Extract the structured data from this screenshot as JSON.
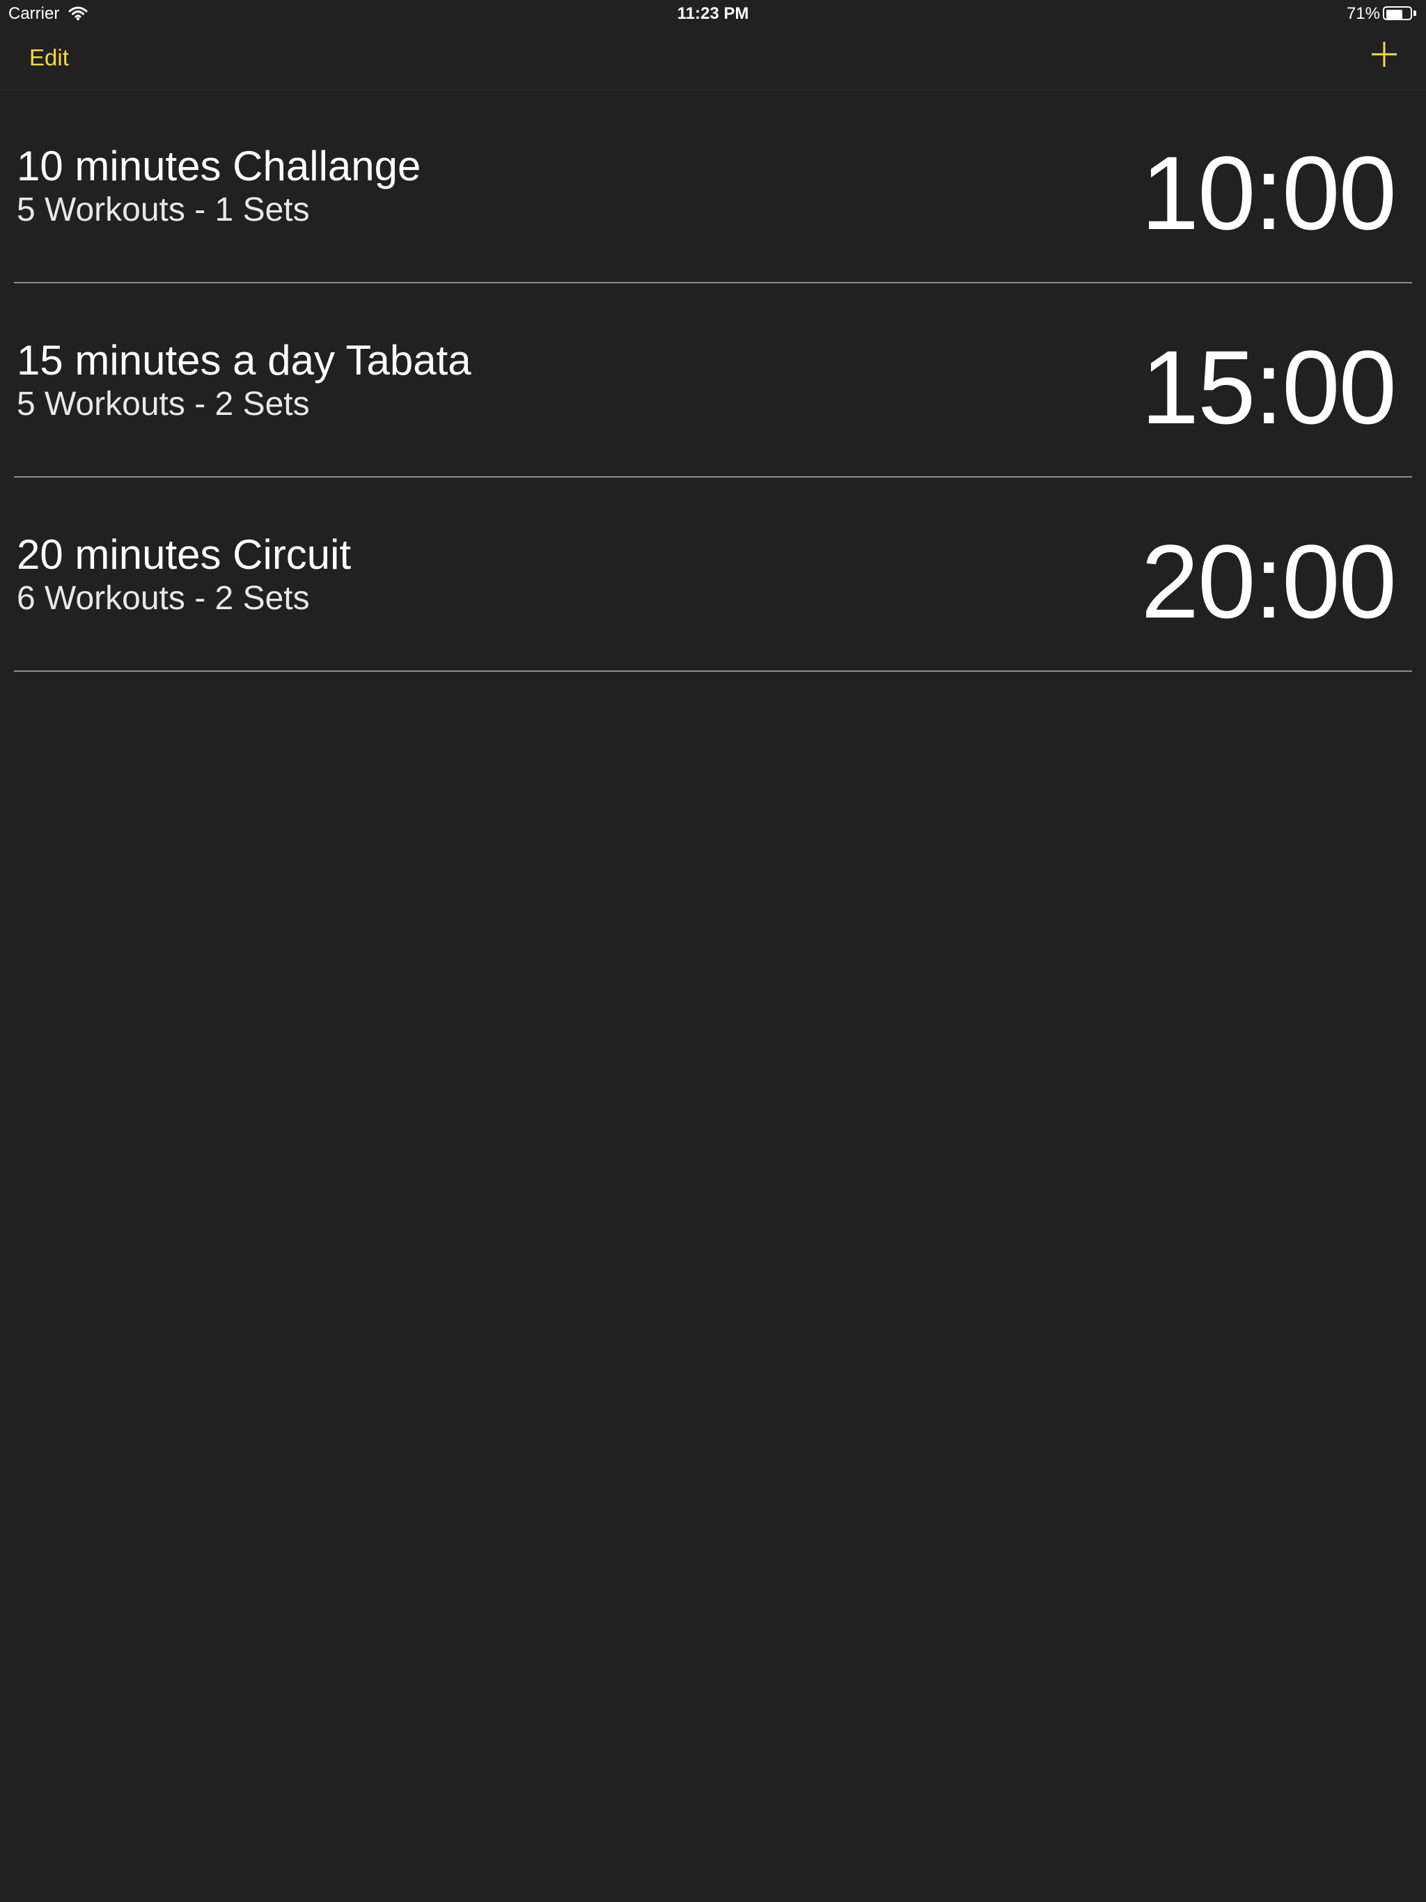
{
  "status_bar": {
    "carrier": "Carrier",
    "time": "11:23 PM",
    "battery_percent": "71%",
    "battery_level": 0.71
  },
  "nav": {
    "edit_label": "Edit",
    "add_icon": "plus-icon"
  },
  "accent_color": "#f7d84b",
  "workouts": [
    {
      "title": "10 minutes Challange",
      "subtitle": "5 Workouts - 1 Sets",
      "duration": "10:00"
    },
    {
      "title": "15 minutes a day Tabata",
      "subtitle": "5 Workouts - 2 Sets",
      "duration": "15:00"
    },
    {
      "title": "20 minutes Circuit",
      "subtitle": "6 Workouts - 2 Sets",
      "duration": "20:00"
    }
  ]
}
